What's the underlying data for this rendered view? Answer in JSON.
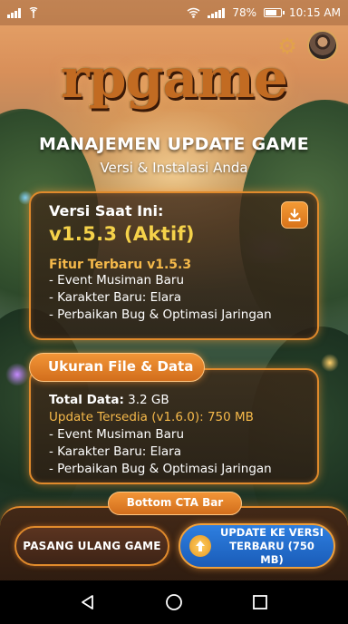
{
  "status_bar": {
    "battery_percent": "78%",
    "time": "10:15 AM",
    "battery_level": 0.78
  },
  "header": {
    "logo_text": "rpgame",
    "title": "MANAJEMEN UPDATE GAME",
    "subtitle": "Versi & Instalasi Anda"
  },
  "current_version_card": {
    "label": "Versi Saat Ini:",
    "version": "v1.5.3 (Aktif)",
    "features_title": "Fitur Terbaru v1.5.3",
    "features": [
      "- Event Musiman Baru",
      "- Karakter Baru: Elara",
      "- Perbaikan Bug & Optimasi Jaringan"
    ]
  },
  "file_data_card": {
    "tab_label": "Ukuran File & Data",
    "total_label": "Total Data:",
    "total_value": "3.2 GB",
    "update_label": "Update Tersedia (v1.6.0):",
    "update_value": "750 MB",
    "items": [
      "- Event Musiman Baru",
      "- Karakter Baru: Elara",
      "- Perbaikan Bug & Optimasi Jaringan"
    ]
  },
  "cta": {
    "bar_label": "Bottom CTA Bar",
    "reinstall_label": "PASANG ULANG GAME",
    "update_line1": "UPDATE KE VERSI",
    "update_line2": "TERBARU (750 MB)"
  },
  "icons": {
    "settings": "gear-icon",
    "download": "download-icon",
    "update": "arrow-up-icon",
    "nav_back": "back-triangle-icon",
    "nav_home": "home-circle-icon",
    "nav_recent": "recent-square-icon"
  },
  "colors": {
    "accent_orange": "#e08a2c",
    "version_yellow": "#f5d24a",
    "highlight_orange": "#f5b94a",
    "update_blue": "#1a5cb8"
  }
}
